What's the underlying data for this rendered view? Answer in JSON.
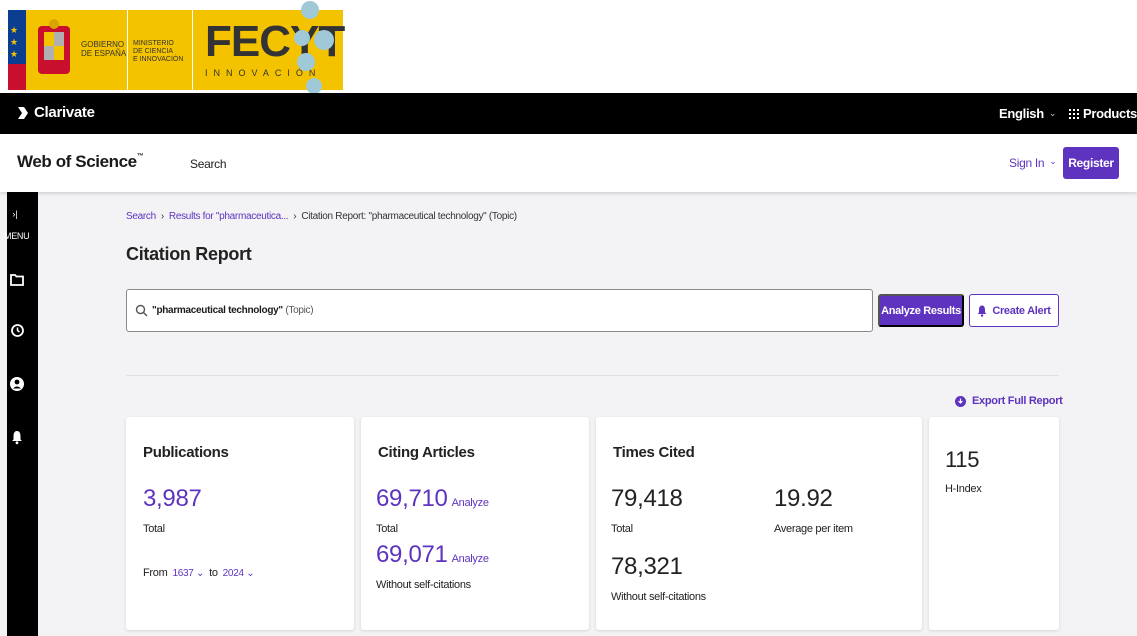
{
  "banner": {
    "gobierno": "GOBIERNO\nDE ESPAÑA",
    "ministerio": "MINISTERIO\nDE CIENCIA\nE INNOVACIÓN",
    "fecyt_title": "FECYT",
    "fecyt_sub": "INNOVACIÓN"
  },
  "topbar": {
    "brand": "Clarivate",
    "language": "English",
    "products": "Products"
  },
  "header": {
    "logo": "Web of Science",
    "logo_tm": "™",
    "search": "Search",
    "sign_in": "Sign In",
    "register": "Register"
  },
  "sidebar": {
    "toggle": "›|",
    "menu": "MENU"
  },
  "breadcrumb": {
    "items": [
      "Search",
      "Results for \"pharmaceutica...",
      "Citation Report: \"pharmaceutical technology\" (Topic)"
    ],
    "separator": "›"
  },
  "page_title": "Citation Report",
  "query": {
    "term": "\"pharmaceutical technology\"",
    "field": "(Topic)"
  },
  "actions": {
    "analyze_results": "Analyze Results",
    "create_alert": "Create Alert",
    "export_full_report": "Export Full Report"
  },
  "cards": {
    "publications": {
      "title": "Publications",
      "value": "3,987",
      "caption": "Total",
      "from_label": "From",
      "from_year": "1637",
      "to_label": "to",
      "to_year": "2024"
    },
    "citing": {
      "title": "Citing Articles",
      "total": "69,710",
      "total_caption": "Total",
      "without_self": "69,071",
      "without_caption": "Without self-citations",
      "analyze": "Analyze"
    },
    "times_cited": {
      "title": "Times Cited",
      "total": "79,418",
      "total_caption": "Total",
      "average": "19.92",
      "average_caption": "Average per item",
      "without_self": "78,321",
      "without_caption": "Without self-citations"
    },
    "h_index": {
      "value": "115",
      "caption": "H-Index"
    }
  },
  "colors": {
    "accent": "#5e33bf",
    "topbar": "#000000",
    "fecyt_yellow": "#f4c300"
  }
}
